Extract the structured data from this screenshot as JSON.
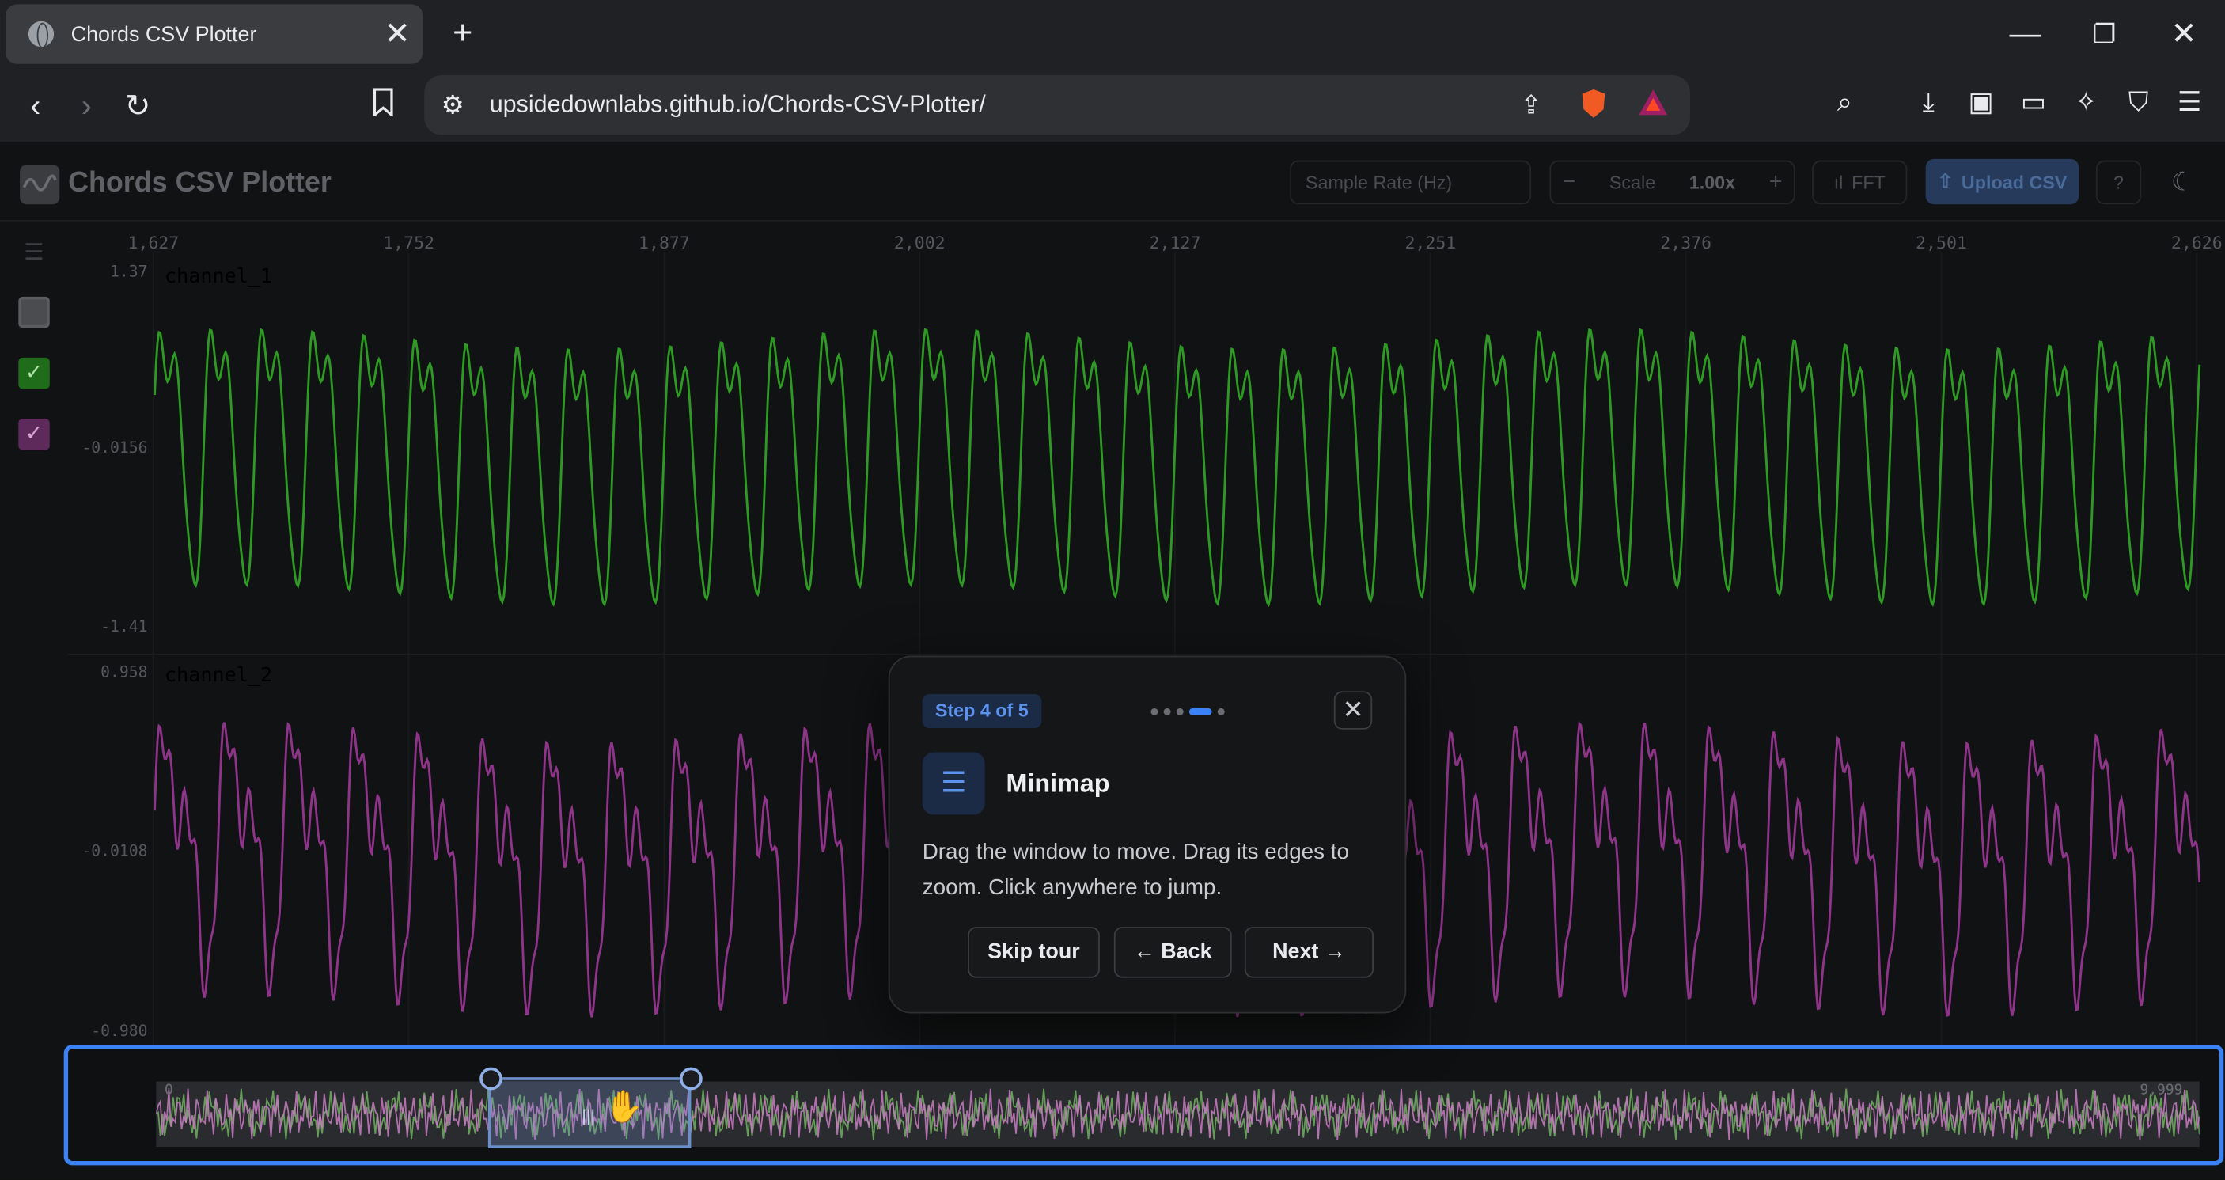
{
  "browser": {
    "tab_title": "Chords CSV Plotter",
    "tab_close": "✕",
    "new_tab": "+",
    "url": "upsidedownlabs.github.io/Chords-CSV-Plotter/",
    "window_controls": {
      "minimize": "—",
      "restore": "❐",
      "close": "✕"
    }
  },
  "app": {
    "title": "Chords CSV Plotter",
    "sample_rate_placeholder": "Sample Rate (Hz)",
    "scale_minus": "−",
    "scale_label": "Scale",
    "scale_value": "1.00x",
    "scale_plus": "+",
    "fft_label": "FFT",
    "upload_label": "Upload CSV",
    "help_label": "?"
  },
  "plot": {
    "x_ticks": [
      "1,627",
      "1,752",
      "1,877",
      "2,002",
      "2,127",
      "2,251",
      "2,376",
      "2,501",
      "2,626"
    ],
    "channels": [
      {
        "name": "channel_1",
        "color": "#2e9a24",
        "y_ticks": [
          "1.37",
          "-0.0156",
          "-1.41"
        ]
      },
      {
        "name": "channel_2",
        "color": "#8e3489",
        "y_ticks": [
          "0.958",
          "-0.0108",
          "-0.980"
        ]
      }
    ]
  },
  "minimap": {
    "start_label": "0",
    "end_label": "9,999",
    "window_fraction_start": 0.163,
    "window_fraction_end": 0.263
  },
  "tour": {
    "step_label": "Step 4 of 5",
    "total_steps": 5,
    "current_step": 4,
    "close": "✕",
    "title": "Minimap",
    "body": "Drag the window to move. Drag its edges to zoom. Click anywhere to jump.",
    "skip_label": "Skip tour",
    "back_label": "← Back",
    "next_label": "Next →"
  }
}
